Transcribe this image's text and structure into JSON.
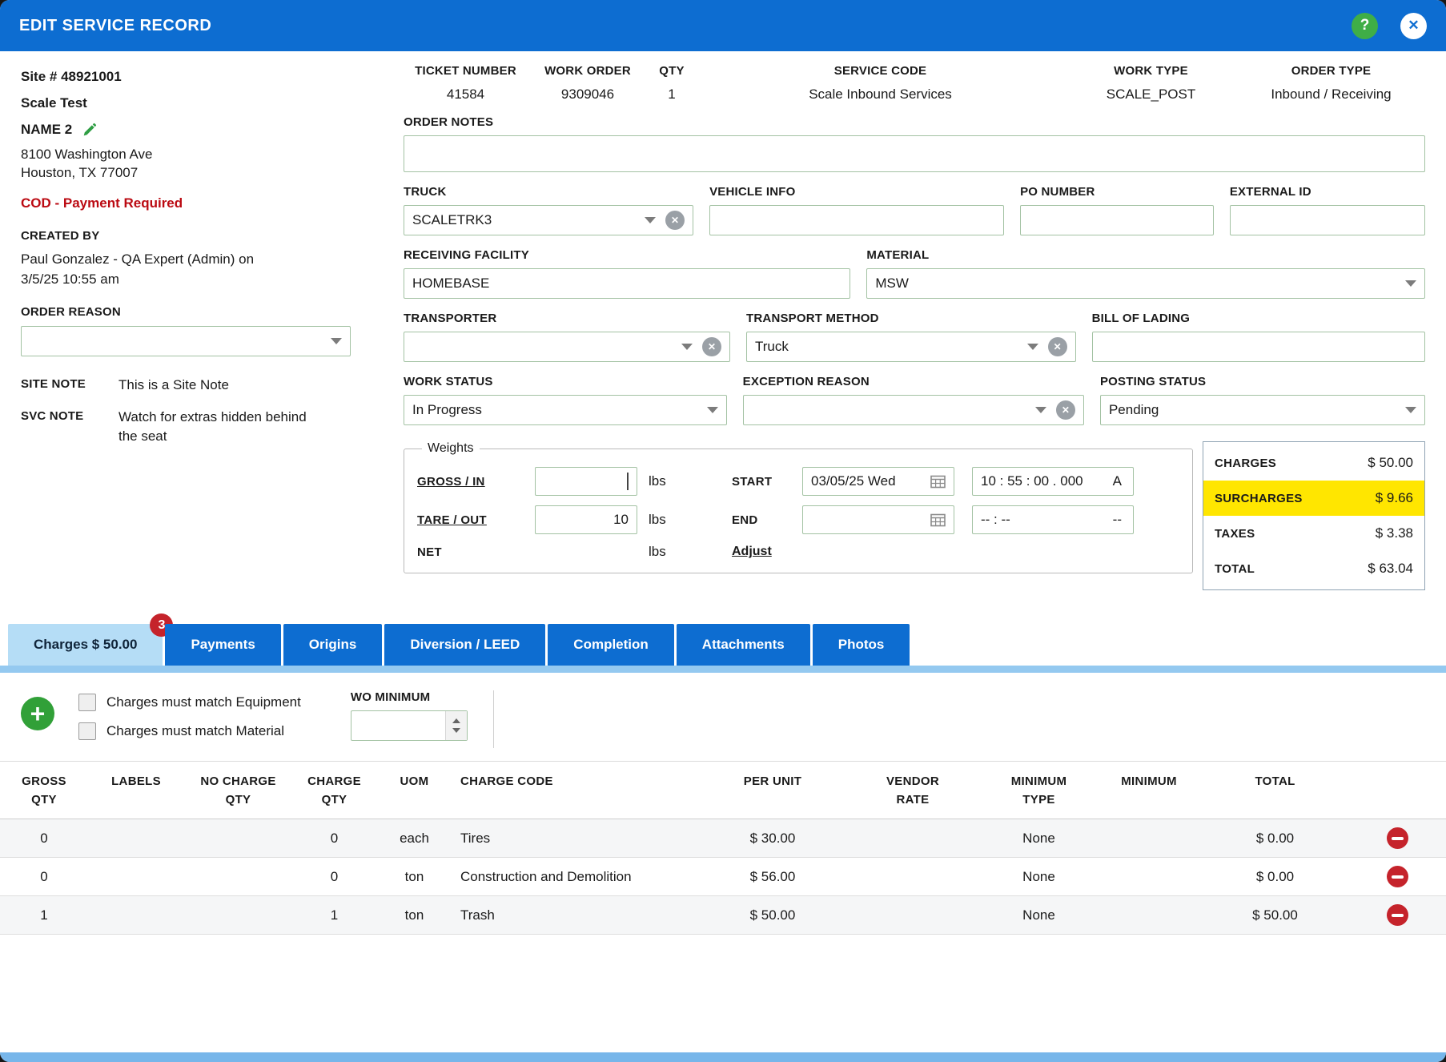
{
  "icons": {
    "help": "?",
    "close": "✕",
    "clear": "✕",
    "add": "+"
  },
  "colors": {
    "header_blue": "#0d6dd1",
    "active_tab_blue": "#b5ddf6",
    "surcharge_highlight_yellow": "#ffe600",
    "badge_red": "#c5232b",
    "delete_red": "#c5232b",
    "add_green": "#31a038",
    "help_green": "#3fae47",
    "cod_red": "#bb0a12"
  },
  "titlebar": {
    "title": "EDIT SERVICE RECORD"
  },
  "site_panel": {
    "site_number": "Site # 48921001",
    "site_name": "Scale Test",
    "contact_name": "NAME 2",
    "address_line1": "8100 Washington Ave",
    "address_line2": "Houston, TX 77007",
    "cod_warning": "COD - Payment Required",
    "created_by_label": "CREATED BY",
    "created_by": "Paul Gonzalez - QA Expert (Admin) on 3/5/25 10:55 am",
    "order_reason_label": "ORDER REASON",
    "order_reason_value": "",
    "site_note_label": "SITE NOTE",
    "site_note_text": "This is a Site Note",
    "svc_note_label": "SVC NOTE",
    "svc_note_text": "Watch for extras hidden behind the seat"
  },
  "summary": {
    "fields": [
      {
        "label": "TICKET NUMBER",
        "value": "41584"
      },
      {
        "label": "WORK ORDER",
        "value": "9309046"
      },
      {
        "label": "QTY",
        "value": "1"
      },
      {
        "label": "SERVICE CODE",
        "value": "Scale Inbound Services"
      },
      {
        "label": "WORK TYPE",
        "value": "SCALE_POST"
      },
      {
        "label": "ORDER TYPE",
        "value": "Inbound / Receiving"
      }
    ]
  },
  "form": {
    "order_notes_label": "ORDER NOTES",
    "order_notes_value": "",
    "truck_label": "TRUCK",
    "truck_value": "SCALETRK3",
    "vehicle_info_label": "VEHICLE INFO",
    "vehicle_info_value": "",
    "po_number_label": "PO NUMBER",
    "po_number_value": "",
    "external_id_label": "EXTERNAL ID",
    "external_id_value": "",
    "receiving_facility_label": "RECEIVING FACILITY",
    "receiving_facility_value": "HOMEBASE",
    "material_label": "MATERIAL",
    "material_value": "MSW",
    "transporter_label": "TRANSPORTER",
    "transporter_value": "",
    "transport_method_label": "TRANSPORT METHOD",
    "transport_method_value": "Truck",
    "bill_of_lading_label": "BILL OF LADING",
    "bill_of_lading_value": "",
    "work_status_label": "WORK STATUS",
    "work_status_value": "In Progress",
    "exception_reason_label": "EXCEPTION REASON",
    "exception_reason_value": "",
    "posting_status_label": "POSTING STATUS",
    "posting_status_value": "Pending"
  },
  "weights": {
    "legend": "Weights",
    "gross_label": "GROSS / IN",
    "gross_value": "",
    "tare_label": "TARE / OUT",
    "tare_value": "10",
    "net_label": "NET",
    "unit": "lbs",
    "start_label": "START",
    "start_date": "03/05/25 Wed",
    "start_time": "10 : 55 : 00 . 000",
    "start_meridiem": "A",
    "end_label": "END",
    "end_date": "",
    "end_time": "-- : --",
    "end_meridiem": "--",
    "adjust_label": "Adjust"
  },
  "totals": {
    "rows": [
      {
        "label": "CHARGES",
        "value": "$ 50.00"
      },
      {
        "label": "SURCHARGES",
        "value": "$ 9.66",
        "highlighted": true
      },
      {
        "label": "TAXES",
        "value": "$ 3.38"
      },
      {
        "label": "TOTAL",
        "value": "$ 63.04"
      }
    ]
  },
  "tabs": [
    {
      "label": "Charges $ 50.00",
      "badge": "3",
      "active": true
    },
    {
      "label": "Payments"
    },
    {
      "label": "Origins"
    },
    {
      "label": "Diversion / LEED"
    },
    {
      "label": "Completion"
    },
    {
      "label": "Attachments"
    },
    {
      "label": "Photos"
    }
  ],
  "charges_panel": {
    "checkbox_equipment_label": "Charges must match Equipment",
    "checkbox_material_label": "Charges must match Material",
    "wo_minimum_label": "WO MINIMUM",
    "wo_minimum_value": ""
  },
  "charges_table": {
    "columns": [
      "GROSS\nQTY",
      "LABELS",
      "NO CHARGE\nQTY",
      "CHARGE\nQTY",
      "UOM",
      "CHARGE CODE",
      "PER UNIT",
      "VENDOR\nRATE",
      "MINIMUM\nTYPE",
      "MINIMUM",
      "TOTAL"
    ],
    "rows": [
      {
        "gross_qty": "0",
        "labels": "",
        "no_charge_qty": "",
        "charge_qty": "0",
        "uom": "each",
        "charge_code": "Tires",
        "per_unit": "$ 30.00",
        "vendor_rate": "",
        "minimum_type": "None",
        "minimum": "",
        "total": "$ 0.00"
      },
      {
        "gross_qty": "0",
        "labels": "",
        "no_charge_qty": "",
        "charge_qty": "0",
        "uom": "ton",
        "charge_code": "Construction and Demolition",
        "per_unit": "$ 56.00",
        "vendor_rate": "",
        "minimum_type": "None",
        "minimum": "",
        "total": "$ 0.00"
      },
      {
        "gross_qty": "1",
        "labels": "",
        "no_charge_qty": "",
        "charge_qty": "1",
        "uom": "ton",
        "charge_code": "Trash",
        "per_unit": "$ 50.00",
        "vendor_rate": "",
        "minimum_type": "None",
        "minimum": "",
        "total": "$ 50.00"
      }
    ]
  }
}
